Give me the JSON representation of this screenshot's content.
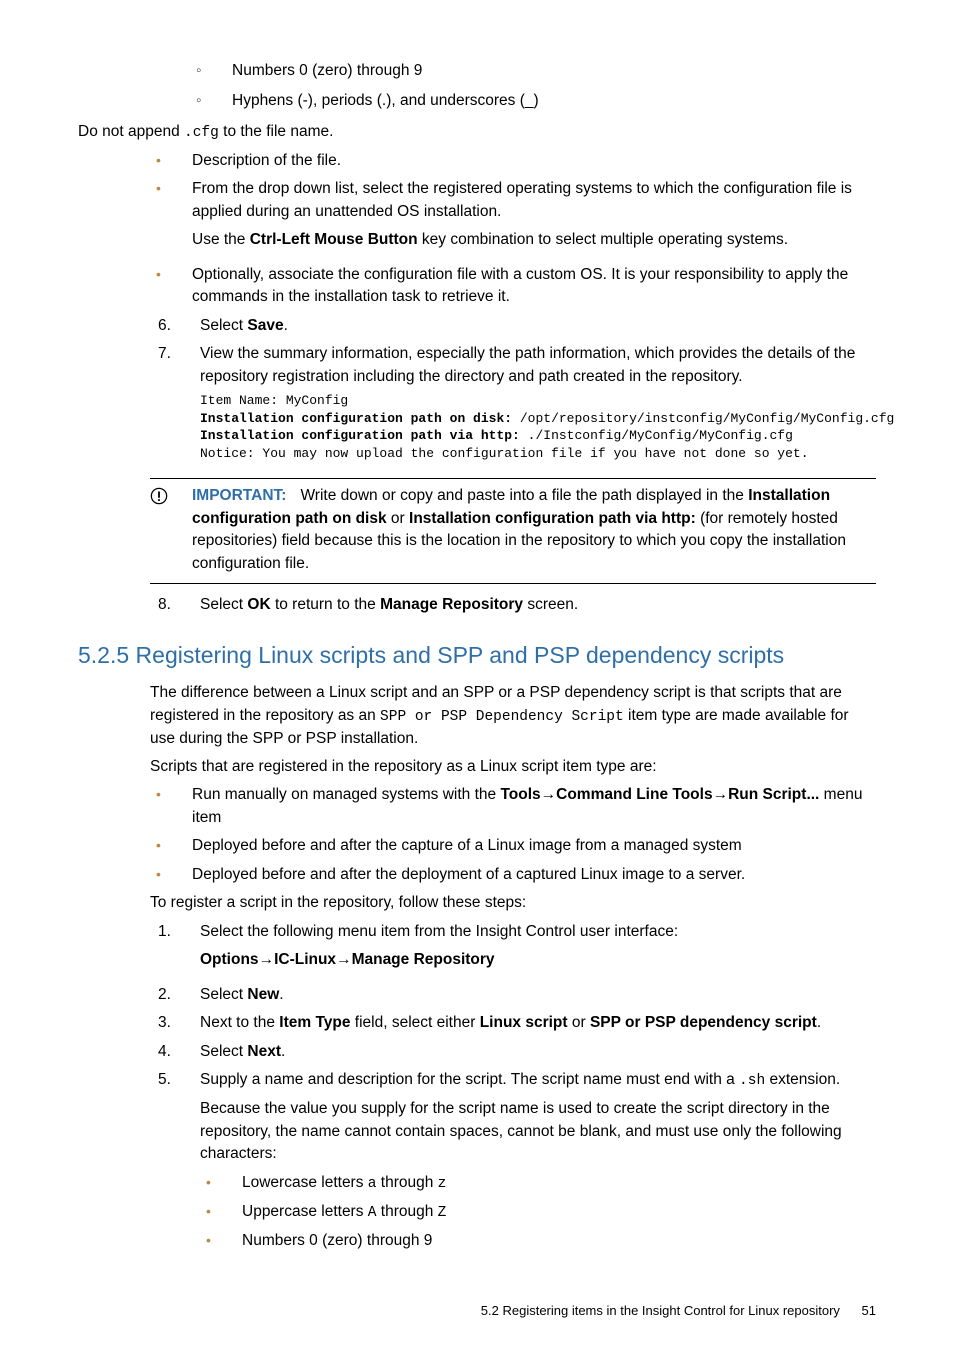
{
  "top": {
    "circle1": "Numbers 0 (zero) through 9",
    "circle2": "Hyphens (-), periods (.), and underscores (_)",
    "noappend_a": "Do not append ",
    "noappend_code": ".cfg",
    "noappend_b": " to the file name.",
    "bullet_desc": "Description of the file.",
    "bullet_dd1": "From the drop down list, select the registered operating systems to which the configuration file is applied during an unattended OS installation.",
    "bullet_dd2a": "Use the ",
    "bullet_dd2b": "Ctrl-Left Mouse Button",
    "bullet_dd2c": " key combination to select multiple operating systems.",
    "bullet_opt": "Optionally, associate the configuration file with a custom OS. It is your responsibility to apply the commands in the installation task to retrieve it."
  },
  "steps": {
    "n6": "6.",
    "s6a": "Select ",
    "s6b": "Save",
    "s6c": ".",
    "n7": "7.",
    "s7": "View the summary information, especially the path information, which provides the details of the repository registration including the directory and path created in the repository.",
    "code_l1a": "Item Name:",
    "code_l1b": " MyConfig",
    "code_l2a": "Installation configuration path on disk:",
    "code_l2b": " /opt/repository/instconfig/MyConfig/MyConfig.cfg",
    "code_l3a": "Installation configuration path via http:",
    "code_l3b": " ./Instconfig/MyConfig/MyConfig.cfg",
    "code_l4": "Notice: You may now upload the configuration file if you have not done so yet.",
    "n8": "8.",
    "s8a": "Select ",
    "s8b": "OK",
    "s8c": " to return to the ",
    "s8d": "Manage Repository",
    "s8e": " screen."
  },
  "important": {
    "label": "IMPORTANT:",
    "t1": "Write down or copy and paste into a file the path displayed in the ",
    "b1": "Installation configuration path on disk",
    "t2": " or ",
    "b2": "Installation configuration path via http:",
    "t3": " (for remotely hosted repositories) field because this is the location in the repository to which you copy the installation configuration file."
  },
  "section": {
    "num": "5.2.5",
    "title": " Registering Linux scripts and SPP and PSP dependency scripts",
    "p1a": "The difference between a Linux script and an SPP or a PSP dependency script is that scripts that are registered in the repository as an ",
    "p1code": "SPP or PSP Dependency Script",
    "p1b": " item type are made available for use during the SPP or PSP installation.",
    "p2": "Scripts that are registered in the repository as a Linux script item type are:",
    "b1a": "Run manually on managed systems with the ",
    "b1b": "Tools",
    "arrow": "→",
    "b1c": "Command Line Tools",
    "b1d": "Run Script...",
    "b1e": " menu item",
    "b2": "Deployed before and after the capture of a Linux image from a managed system",
    "b3": "Deployed before and after the deployment of a captured Linux image to a server.",
    "p3": "To register a script in the repository, follow these steps:"
  },
  "steps2": {
    "n1": "1.",
    "s1": "Select the following menu item from the Insight Control user interface:",
    "menu_a": "Options",
    "menu_b": "IC-Linux",
    "menu_c": "Manage Repository",
    "n2": "2.",
    "s2a": "Select ",
    "s2b": "New",
    "s2c": ".",
    "n3": "3.",
    "s3a": "Next to the ",
    "s3b": "Item Type",
    "s3c": " field, select either ",
    "s3d": "Linux script",
    "s3e": " or ",
    "s3f": "SPP or PSP dependency script",
    "s3g": ".",
    "n4": "4.",
    "s4a": "Select ",
    "s4b": "Next",
    "s4c": ".",
    "n5": "5.",
    "s5a": "Supply a name and description for the script. The script name must end with a ",
    "s5code": ".sh",
    "s5b": " extension.",
    "s5p2": "Because the value you supply for the script name is used to create the script directory in the repository, the name cannot contain spaces, cannot be blank, and must use only the following characters:",
    "sub1a": "Lowercase letters ",
    "sub1code1": "a",
    "sub1b": " through ",
    "sub1code2": "z",
    "sub2a": "Uppercase letters ",
    "sub2code1": "A",
    "sub2b": " through ",
    "sub2code2": "Z",
    "sub3": "Numbers 0 (zero) through 9"
  },
  "footer": {
    "text": "5.2 Registering items in the Insight Control for Linux repository",
    "page": "51"
  }
}
